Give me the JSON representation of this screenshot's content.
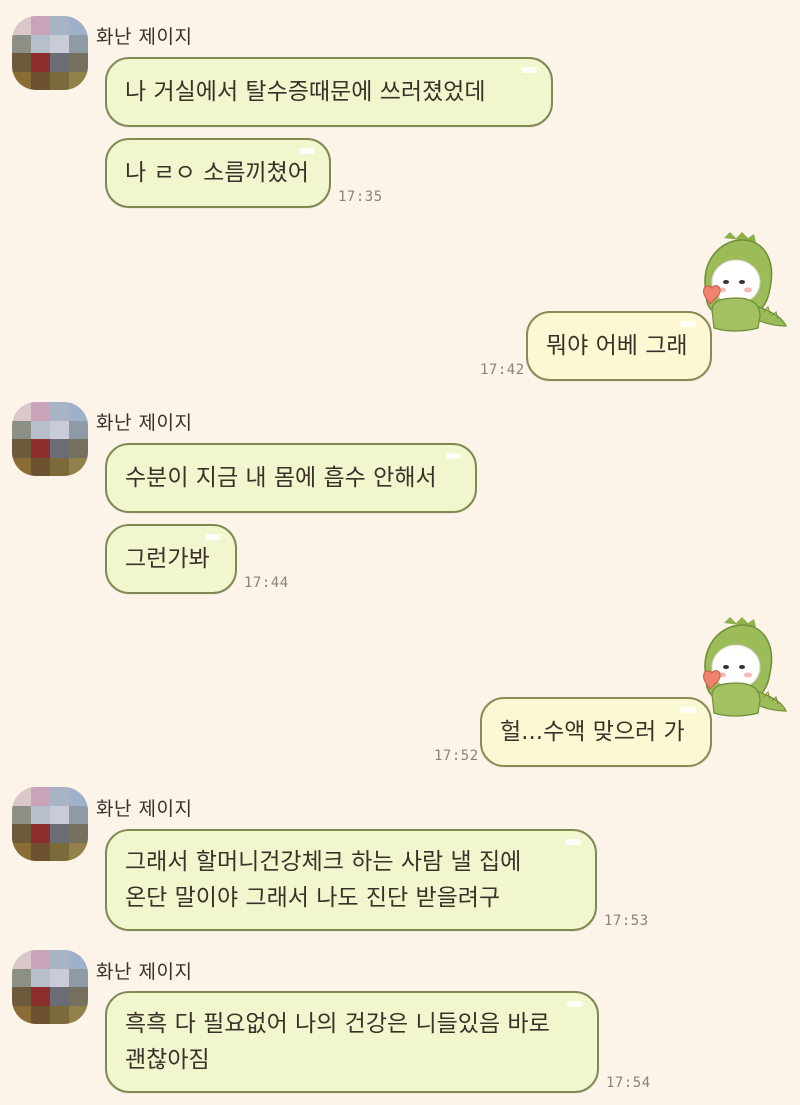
{
  "sender_name": "화난 제이지",
  "messages": [
    {
      "from": "friend",
      "text": "나 거실에서 탈수증때문에 쓰러졌었데"
    },
    {
      "from": "friend",
      "text": "나 ㄹㅇ 소름끼쳤어",
      "time": "17:35"
    },
    {
      "from": "me",
      "text": "뭐야 어베 그래",
      "time": "17:42"
    },
    {
      "from": "friend",
      "text": "수분이 지금 내 몸에 흡수 안해서"
    },
    {
      "from": "friend",
      "text": "그런가봐",
      "time": "17:44"
    },
    {
      "from": "me",
      "text": "헐...수액 맞으러 가",
      "time": "17:52"
    },
    {
      "from": "friend",
      "lines": [
        "그래서  할머니건강체크 하는 사람 낼 집에",
        "온단 말이야 그래서 나도 진단 받을려구"
      ],
      "time": "17:53"
    },
    {
      "from": "friend",
      "lines": [
        "흑흑 다 필요없어 나의 건강은 니들있음 바로",
        "괜찮아짐"
      ],
      "time": "17:54"
    }
  ],
  "colors": {
    "background": "#fcf3e9",
    "friend_bubble": "#f2f6cf",
    "my_bubble": "#fcf8d4",
    "bubble_border": "#7f8a52",
    "time_text": "#8d8278"
  },
  "icons": {
    "sticker": "dinosaur-costume-character-with-heart-sticker",
    "avatar": "pixelated-profile-photo"
  }
}
